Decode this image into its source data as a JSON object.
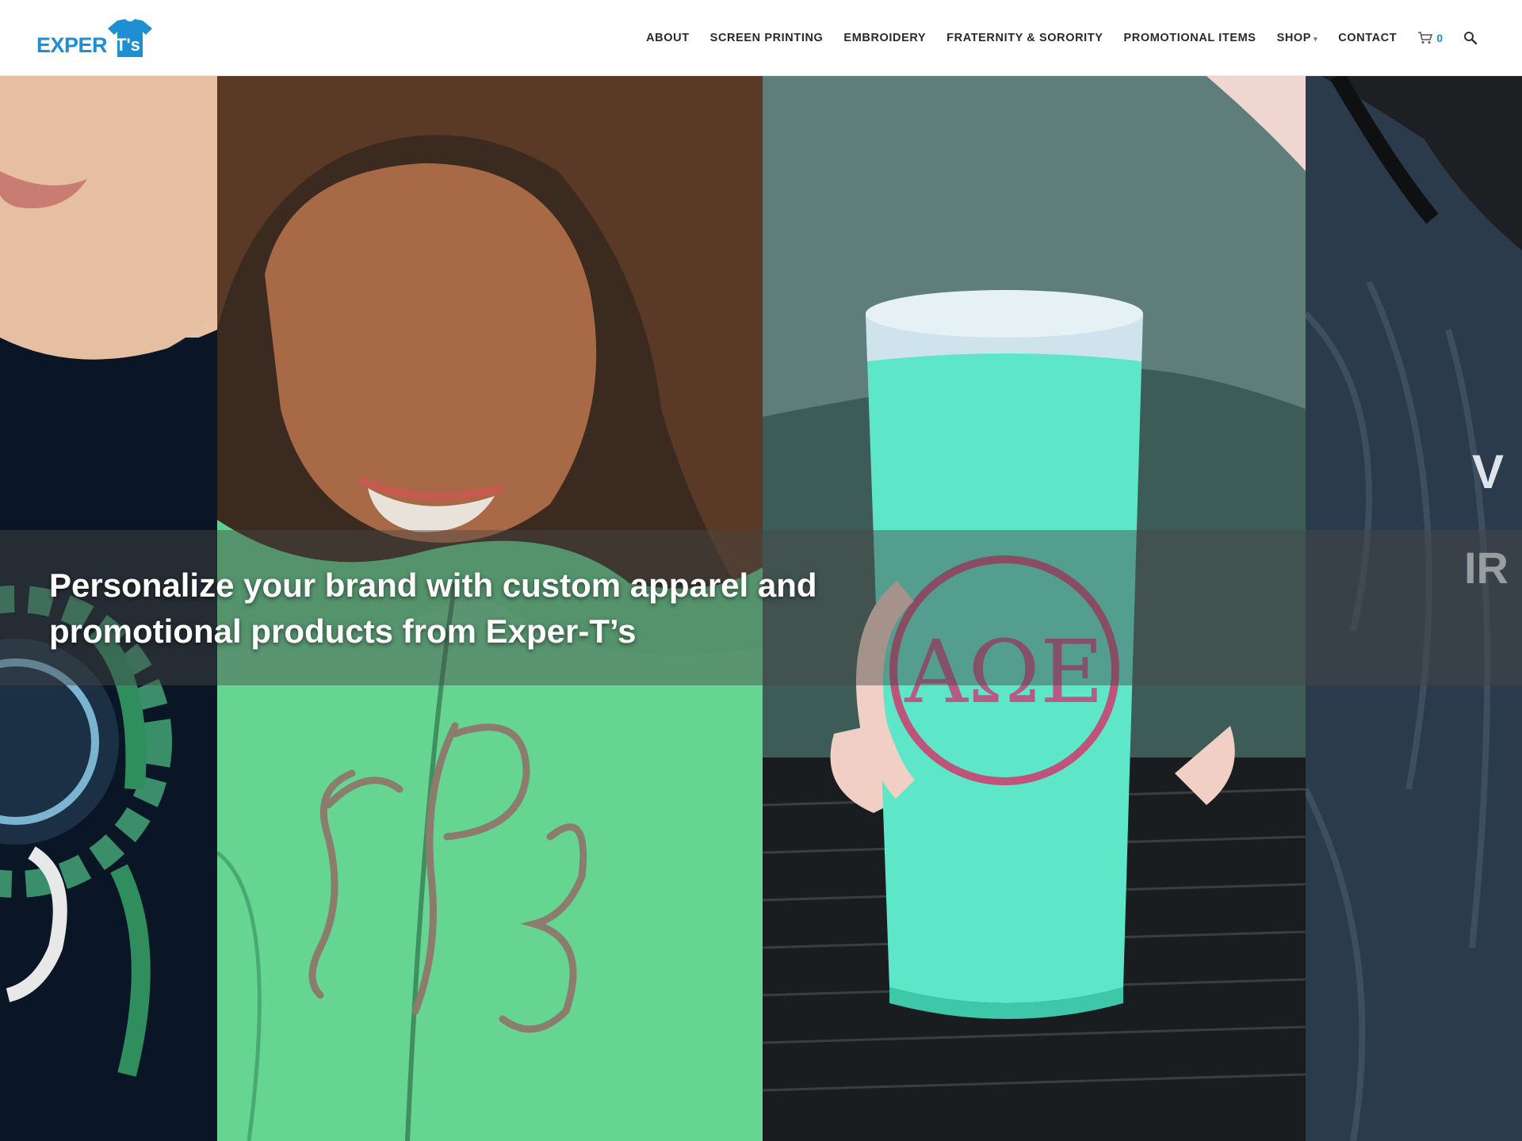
{
  "brand": {
    "logo_text": "EXPER",
    "logo_shirt_text": "T's",
    "logo_color": "#1f8fd3"
  },
  "nav": {
    "items": [
      {
        "label": "ABOUT"
      },
      {
        "label": "SCREEN PRINTING"
      },
      {
        "label": "EMBROIDERY"
      },
      {
        "label": "FRATERNITY & SORORITY"
      },
      {
        "label": "PROMOTIONAL ITEMS"
      },
      {
        "label": "SHOP"
      },
      {
        "label": "CONTACT"
      }
    ],
    "cart_count": "0",
    "icons": [
      "cart-icon",
      "search-icon",
      "chevron-down-icon"
    ]
  },
  "hero": {
    "headline": "Personalize your brand with custom apparel and promotional products from Exper-T’s",
    "panels": [
      "graphic-tee-photo",
      "monogrammed-jacket-photo",
      "sorority-tumbler-photo",
      "embroidered-shirt-photo"
    ],
    "tumbler_letters": "ΑΩΕ",
    "monogram_letters": "IPB"
  }
}
